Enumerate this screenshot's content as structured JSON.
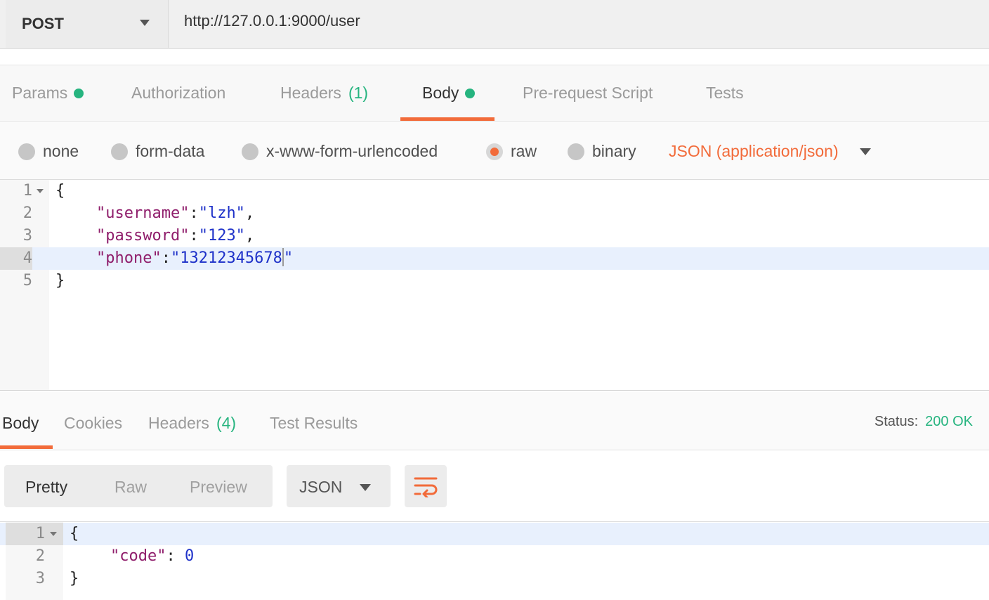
{
  "request": {
    "method": "POST",
    "url": "http://127.0.0.1:9000/user"
  },
  "request_tabs": [
    {
      "label": "Params",
      "has_dot": true
    },
    {
      "label": "Authorization"
    },
    {
      "label": "Headers",
      "count": "(1)"
    },
    {
      "label": "Body",
      "has_dot": true,
      "active": true
    },
    {
      "label": "Pre-request Script"
    },
    {
      "label": "Tests"
    }
  ],
  "body_modes": {
    "options": [
      "none",
      "form-data",
      "x-www-form-urlencoded",
      "raw",
      "binary"
    ],
    "selected": "raw",
    "content_type": "JSON (application/json)"
  },
  "request_body": {
    "line_numbers": [
      "1",
      "2",
      "3",
      "4",
      "5"
    ],
    "open_brace": "{",
    "close_brace": "}",
    "fields": [
      {
        "key": "\"username\"",
        "value": "\"lzh\"",
        "trail": ","
      },
      {
        "key": "\"password\"",
        "value": "\"123\"",
        "trail": ","
      },
      {
        "key": "\"phone\"",
        "value": "\"13212345678",
        "trail": "\""
      }
    ],
    "colon": ":"
  },
  "response_tabs": [
    {
      "label": "Body",
      "active": true
    },
    {
      "label": "Cookies"
    },
    {
      "label": "Headers",
      "count": "(4)"
    },
    {
      "label": "Test Results"
    }
  ],
  "status": {
    "label": "Status:",
    "value": "200 OK"
  },
  "view_modes": [
    "Pretty",
    "Raw",
    "Preview"
  ],
  "view_mode_selected": "Pretty",
  "format": "JSON",
  "response_body": {
    "line_numbers": [
      "1",
      "2",
      "3"
    ],
    "open_brace": "{",
    "close_brace": "}",
    "key": "\"code\"",
    "colon": ": ",
    "value": "0"
  },
  "colors": {
    "accent": "#f26b3a",
    "success": "#26b47f",
    "highlight": "#e8f0fd"
  },
  "icons": {
    "method_caret": "chevron-down-icon",
    "wrap": "wrap-lines-icon"
  }
}
